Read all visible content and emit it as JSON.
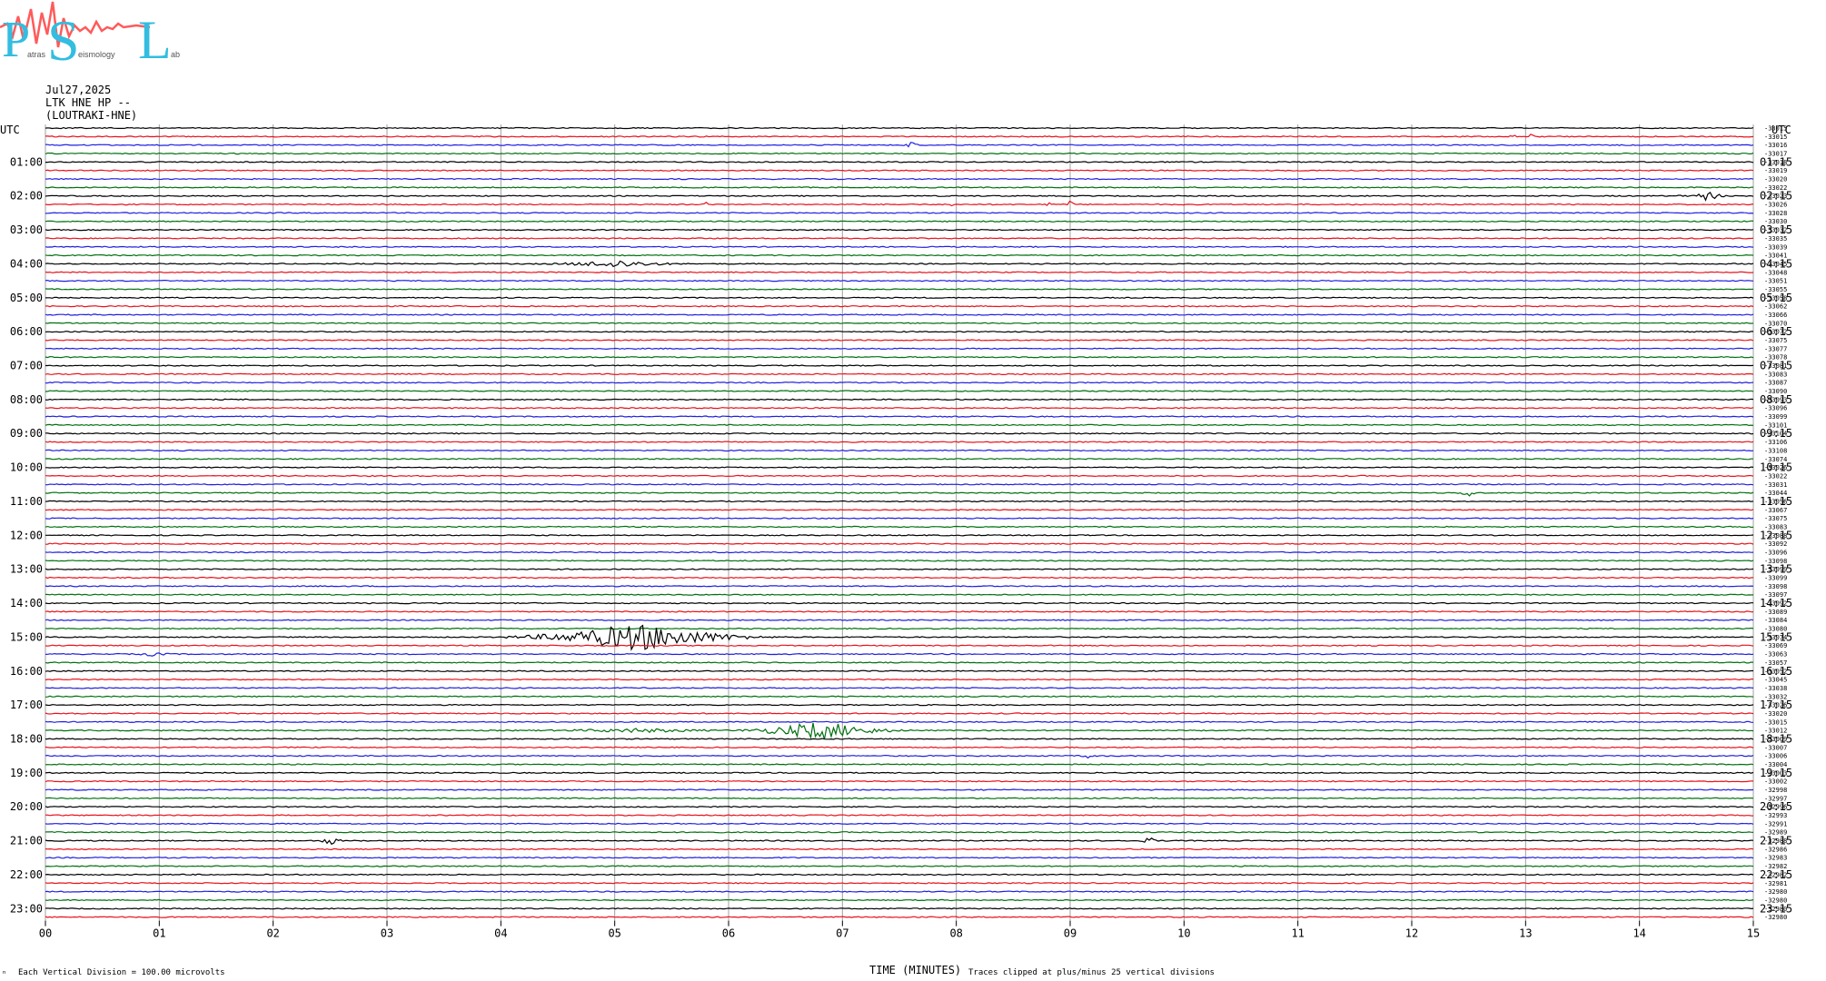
{
  "logo": {
    "letters": [
      "P",
      "S",
      "L"
    ],
    "words": [
      "atras",
      "eismology",
      "ab"
    ],
    "colors": {
      "letters": "#33bde0",
      "wave": "#ff5a5a",
      "words": "#555555"
    }
  },
  "header": {
    "date": "Jul27,2025",
    "station": "LTK HNE HP --",
    "location": "(LOUTRAKI-HNE)"
  },
  "colors": {
    "black": "#000000",
    "red": "#e8111a",
    "blue": "#1f1fe0",
    "green": "#00700f",
    "grid": "#a0a0a0"
  },
  "chart_data": {
    "type": "line",
    "title": "",
    "xlabel": "TIME (MINUTES)",
    "ylabel": "UTC",
    "right_ylabel": "UTC",
    "x_range": [
      0,
      15
    ],
    "x_ticks": [
      "00",
      "01",
      "02",
      "03",
      "04",
      "05",
      "06",
      "07",
      "08",
      "09",
      "10",
      "11",
      "12",
      "13",
      "14",
      "15"
    ],
    "rows_per_hour": 4,
    "row_colors": [
      "black",
      "red",
      "blue",
      "green"
    ],
    "left_labels": [
      "01:00",
      "02:00",
      "03:00",
      "04:00",
      "05:00",
      "06:00",
      "07:00",
      "08:00",
      "09:00",
      "10:00",
      "11:00",
      "12:00",
      "13:00",
      "14:00",
      "15:00",
      "16:00",
      "17:00",
      "18:00",
      "19:00",
      "20:00",
      "21:00",
      "22:00",
      "23:00"
    ],
    "right_labels": [
      "01:15",
      "02:15",
      "03:15",
      "04:15",
      "05:15",
      "06:15",
      "07:15",
      "08:15",
      "09:15",
      "10:15",
      "11:15",
      "12:15",
      "13:15",
      "14:15",
      "15:15",
      "16:15",
      "17:15",
      "18:15",
      "19:15",
      "20:15",
      "21:15",
      "22:15",
      "23:15"
    ],
    "right_values": [
      "-33015",
      "-33015",
      "-33016",
      "-33017",
      "-33018",
      "-33019",
      "-33020",
      "-33022",
      "-33023",
      "-33026",
      "-33028",
      "-33030",
      "-33032",
      "-33035",
      "-33039",
      "-33041",
      "-33045",
      "-33048",
      "-33051",
      "-33055",
      "-33058",
      "-33062",
      "-33066",
      "-33070",
      "-33072",
      "-33075",
      "-33077",
      "-33078",
      "-33081",
      "-33083",
      "-33087",
      "-33090",
      "-33093",
      "-33096",
      "-33099",
      "-33101",
      "-33104",
      "-33106",
      "-33108",
      "-33074",
      "-33026",
      "-33022",
      "-33031",
      "-33044",
      "-33056",
      "-33067",
      "-33075",
      "-33083",
      "-33088",
      "-33092",
      "-33096",
      "-33098",
      "-33099",
      "-33099",
      "-33098",
      "-33097",
      "-33092",
      "-33089",
      "-33084",
      "-33080",
      "-33074",
      "-33069",
      "-33063",
      "-33057",
      "-33052",
      "-33045",
      "-33038",
      "-33032",
      "-33026",
      "-33020",
      "-33015",
      "-33012",
      "-33009",
      "-33007",
      "-33006",
      "-33004",
      "-33003",
      "-33002",
      "-32998",
      "-32997",
      "-32996",
      "-32993",
      "-32991",
      "-32989",
      "-32988",
      "-32986",
      "-32983",
      "-32982",
      "-32982",
      "-32981",
      "-32980",
      "-32980",
      "-32980",
      "-32980"
    ],
    "events": [
      {
        "row": 2,
        "minute": 7.6,
        "width": 0.08,
        "amp": 4
      },
      {
        "row": 1,
        "minute": 12.9,
        "width": 0.05,
        "amp": 3
      },
      {
        "row": 1,
        "minute": 13.05,
        "width": 0.05,
        "amp": 3
      },
      {
        "row": 8,
        "minute": 14.6,
        "width": 0.2,
        "amp": 5
      },
      {
        "row": 8,
        "minute": 14.35,
        "width": 0.05,
        "amp": 3
      },
      {
        "row": 9,
        "minute": 5.8,
        "width": 0.02,
        "amp": 4
      },
      {
        "row": 9,
        "minute": 7.95,
        "width": 0.02,
        "amp": 5
      },
      {
        "row": 9,
        "minute": 8.8,
        "width": 0.05,
        "amp": 3
      },
      {
        "row": 9,
        "minute": 9.0,
        "width": 0.05,
        "amp": 4
      },
      {
        "row": 16,
        "minute": 5.0,
        "width": 0.7,
        "amp": 4
      },
      {
        "row": 43,
        "minute": 12.5,
        "width": 0.1,
        "amp": 6
      },
      {
        "row": 60,
        "minute": 5.2,
        "width": 1.4,
        "amp": 15
      },
      {
        "row": 62,
        "minute": 0.95,
        "width": 0.2,
        "amp": 2
      },
      {
        "row": 71,
        "minute": 6.8,
        "width": 0.9,
        "amp": 10
      },
      {
        "row": 71,
        "minute": 5.2,
        "width": 1.0,
        "amp": 2
      },
      {
        "row": 74,
        "minute": 9.15,
        "width": 0.08,
        "amp": 4
      },
      {
        "row": 84,
        "minute": 2.5,
        "width": 0.15,
        "amp": 4
      },
      {
        "row": 84,
        "minute": 9.7,
        "width": 0.1,
        "amp": 4
      }
    ]
  },
  "footer": {
    "scale_note": "Each Vertical Division =  100.00 microvolts",
    "clip_note": "Traces clipped at plus/minus 25 vertical divisions",
    "corner_mark": "ⁿ"
  }
}
